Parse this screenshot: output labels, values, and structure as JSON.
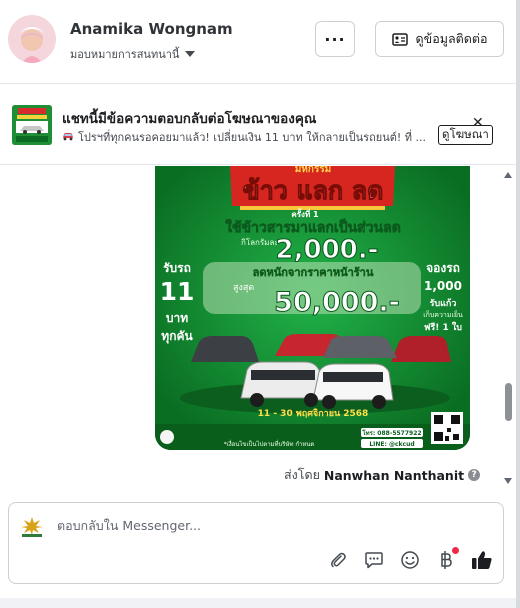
{
  "header": {
    "name": "Anamika Wongnam",
    "subtitle": "มอบหมายการสนทนานี้",
    "more_label": "···",
    "contact_label": "ดูข้อมูลติดต่อ"
  },
  "banner": {
    "title": "แชทนี้มีข้อความตอบกลับต่อโฆษณาของคุณ",
    "subtitle": "โปรฯที่ทุกคนรอคอยมาแล้ว! เปลี่ยนเงิน 11 บาท ให้กลายเป็นรถยนต์! ที่ ...",
    "view_ad_label": "ดูโฆษณา",
    "close_label": "✕"
  },
  "ad": {
    "t1": "มหกรรม",
    "t2": "ข้าว แลก ลด",
    "t3": "ครั้งที่ 1",
    "t4": "ใช้ข้าวสารมาแลกเป็นส่วนลด",
    "t5": "กิโลกรัมละ",
    "t6": "2,000.-",
    "t7": "ลดหนักจากราคาหน้าร้าน",
    "t8": "สูงสุด",
    "t9": "50,000.-",
    "left1": "รับรถ",
    "left2": "11",
    "left3": "บาท",
    "left4": "ทุกคัน",
    "right1": "จองรถ",
    "right2": "1,000",
    "right3": "รับแก้ว",
    "right4": "เก็บความเย็น",
    "right5": "ฟรี! 1 ใบ",
    "date": "11 - 30 พฤศจิกายน 2568",
    "tel": "โทร: 088-5577922",
    "line": "LINE: @ckcud",
    "terms": "*เงื่อนไขเป็นไปตามที่บริษัท กำหนด"
  },
  "conversation": {
    "sent_by_prefix": "ส่งโดย",
    "sent_by_name": "Nanwhan Nanthanit",
    "info_icon": "?"
  },
  "composer": {
    "placeholder": "ตอบกลับใน Messenger..."
  },
  "colors": {
    "ad_green": "#0f8a2c",
    "like_blue": "#1c1e21",
    "notification_red": "#f02849"
  },
  "icons": [
    "more-icon",
    "contact-card-icon",
    "caret-down-icon",
    "car-emoji-icon",
    "close-icon",
    "info-icon",
    "attachment-icon",
    "saved-reply-icon",
    "emoji-icon",
    "baht-icon",
    "like-icon"
  ]
}
